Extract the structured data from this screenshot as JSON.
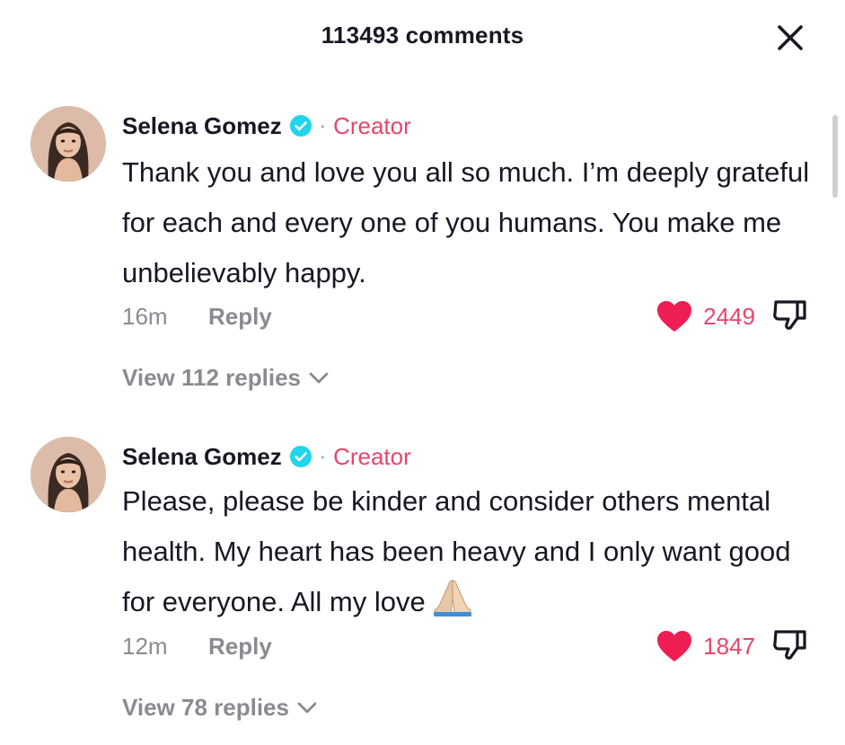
{
  "header": {
    "title": "113493 comments"
  },
  "colors": {
    "creator": "#e8456b",
    "like": "#e8456b",
    "heart": "#ee1d52",
    "verified": "#20d5ec",
    "muted": "#8a8b91"
  },
  "comments": [
    {
      "author": "Selena Gomez",
      "separator": "·",
      "badge": "Creator",
      "text": "Thank you and love you all so much. I’m deeply grateful for each and every one of you humans. You make me unbelievably happy.",
      "time": "16m",
      "reply_label": "Reply",
      "likes": "2449",
      "view_replies": "View 112 replies"
    },
    {
      "author": "Selena Gomez",
      "separator": "·",
      "badge": "Creator",
      "text": "Please, please be kinder and consider others mental health. My heart has been heavy and I only want good for everyone. All my love",
      "emoji": "folded-hands",
      "time": "12m",
      "reply_label": "Reply",
      "likes": "1847",
      "view_replies": "View 78 replies"
    }
  ]
}
